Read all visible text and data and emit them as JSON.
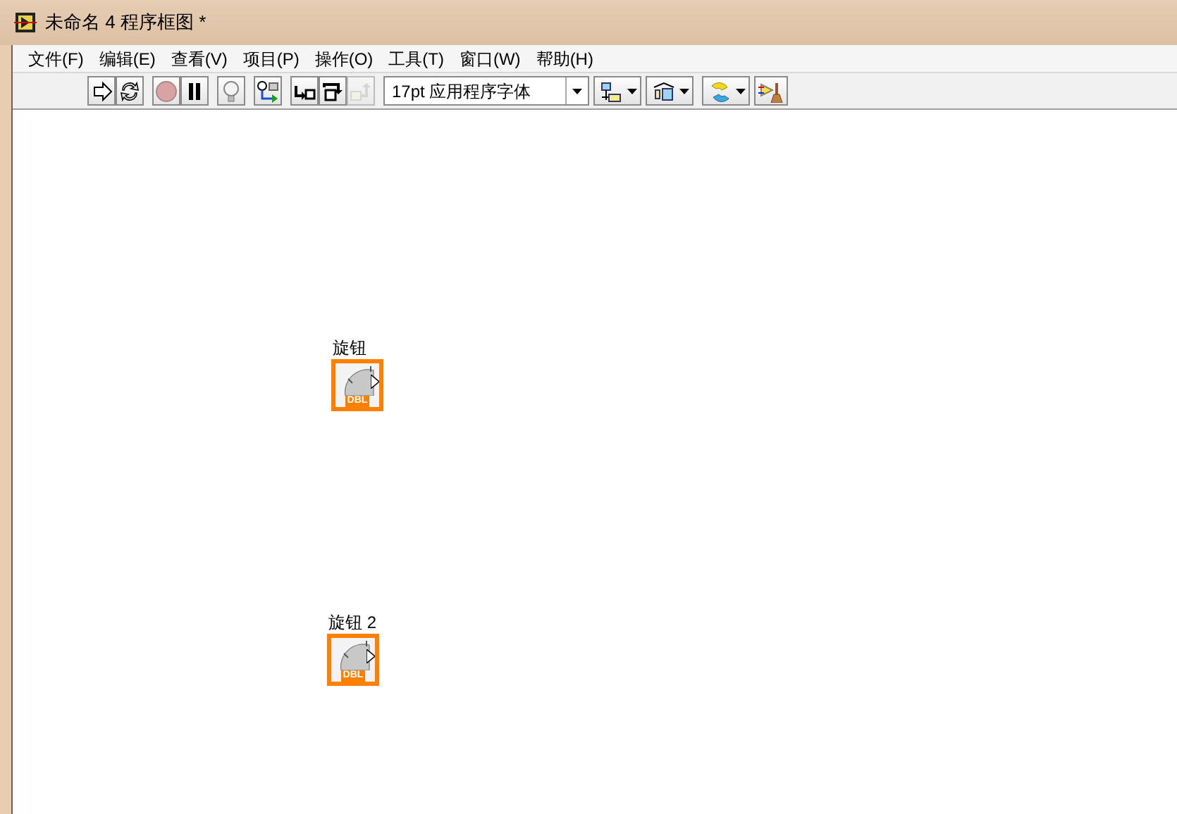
{
  "window": {
    "title": "未命名 4 程序框图 *"
  },
  "menu": [
    "文件(F)",
    "编辑(E)",
    "查看(V)",
    "项目(P)",
    "操作(O)",
    "工具(T)",
    "窗口(W)",
    "帮助(H)"
  ],
  "toolbar": [
    {
      "kind": "run",
      "disabled": false
    },
    {
      "kind": "run-continuously",
      "disabled": false
    },
    {
      "kind": "abort",
      "disabled": false
    },
    {
      "kind": "pause",
      "disabled": false
    },
    {
      "kind": "highlight",
      "disabled": false
    },
    {
      "kind": "retain",
      "disabled": false
    },
    {
      "kind": "step-into",
      "disabled": false
    },
    {
      "kind": "step-over",
      "disabled": false
    },
    {
      "kind": "step-out",
      "disabled": true
    }
  ],
  "font_selector": {
    "value": "17pt 应用程序字体"
  },
  "tools": [
    {
      "kind": "align"
    },
    {
      "kind": "distribute"
    },
    {
      "kind": "reorder"
    },
    {
      "kind": "cleanup"
    }
  ],
  "nodes": [
    {
      "label": "旋钮",
      "type": "DBL"
    },
    {
      "label": "旋钮 2",
      "type": "DBL"
    }
  ]
}
